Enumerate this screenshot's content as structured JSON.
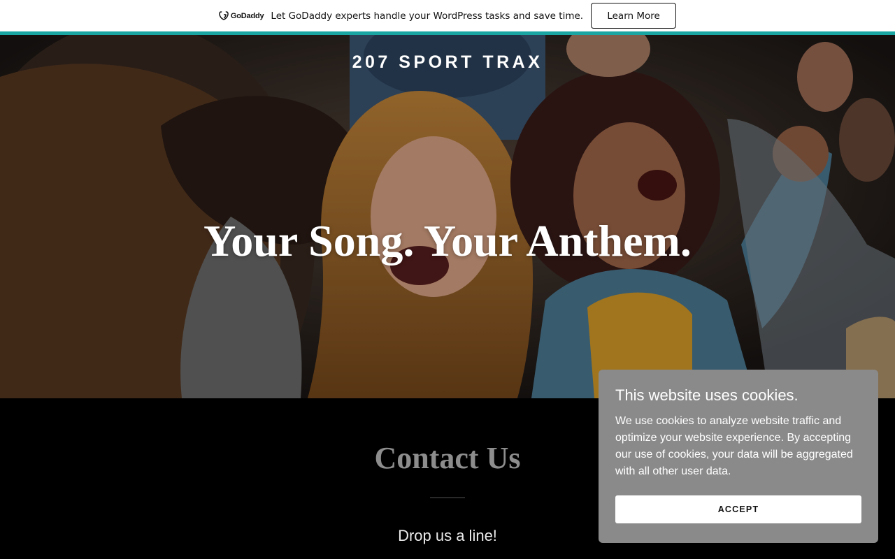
{
  "promo": {
    "logo_text": "GoDaddy",
    "message": "Let GoDaddy experts handle your WordPress tasks and save time.",
    "cta_label": "Learn More",
    "accent_color": "#1aa6a3"
  },
  "hero": {
    "site_title": "207 SPORT TRAX",
    "headline": "Your Song. Your Anthem."
  },
  "contact": {
    "title": "Contact Us",
    "subtitle": "Drop us a line!"
  },
  "cookie_notice": {
    "title": "This website uses cookies.",
    "body": "We use cookies to analyze website traffic and optimize your website experience. By accepting our use of cookies, your data will be aggregated with all other user data.",
    "accept_label": "ACCEPT"
  }
}
